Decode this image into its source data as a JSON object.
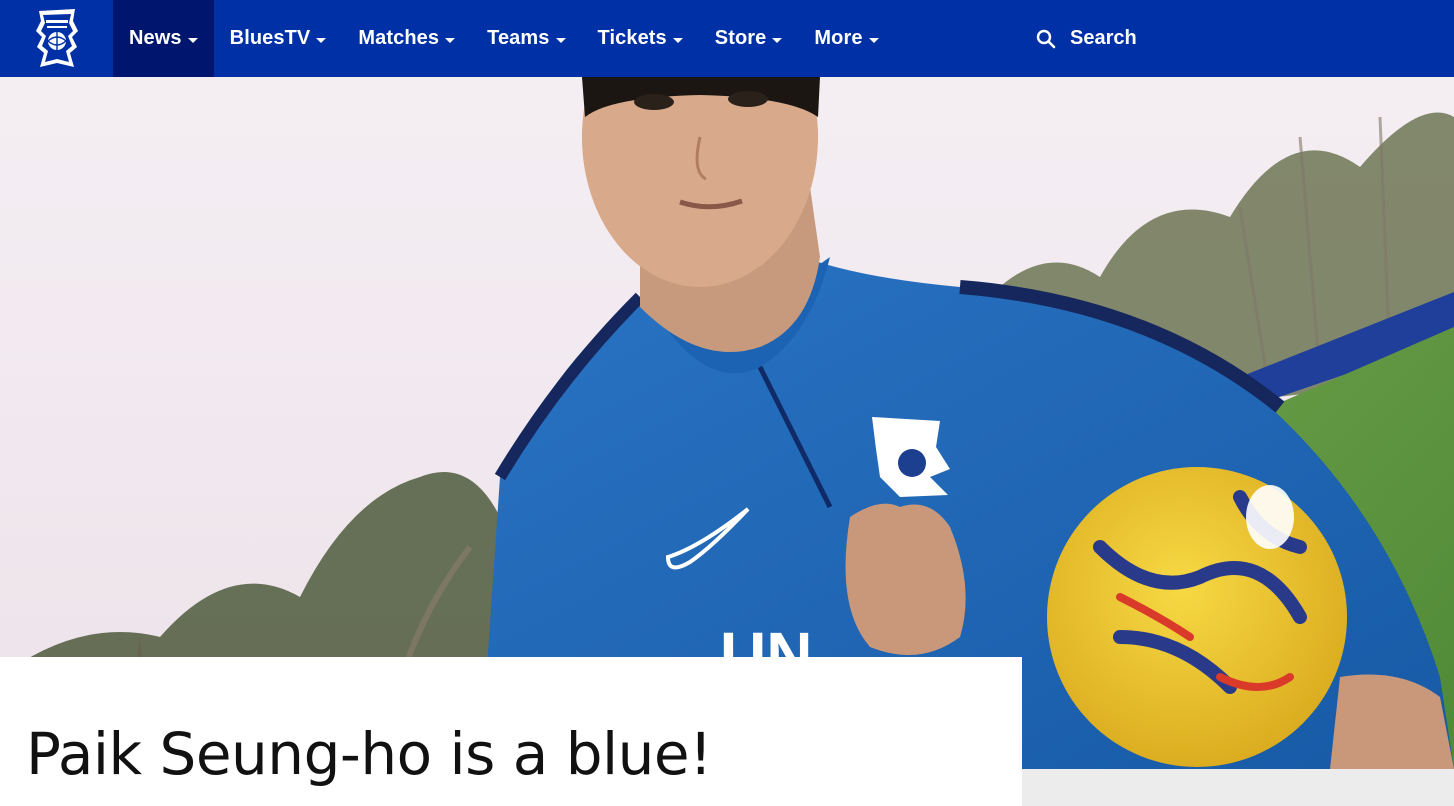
{
  "nav": {
    "logo_name": "birmingham-city-crest",
    "items": [
      {
        "label": "News",
        "active": true
      },
      {
        "label": "BluesTV"
      },
      {
        "label": "Matches"
      },
      {
        "label": "Teams"
      },
      {
        "label": "Tickets"
      },
      {
        "label": "Store"
      },
      {
        "label": "More"
      }
    ],
    "search_label": "Search"
  },
  "hero": {
    "image": "player-portrait"
  },
  "article": {
    "headline": "Paik Seung-ho is a blue!"
  },
  "colors": {
    "nav_bg": "#0030a5",
    "nav_active": "#00156e",
    "kit_blue": "#1e63b0",
    "ball_yellow": "#f1c830"
  }
}
